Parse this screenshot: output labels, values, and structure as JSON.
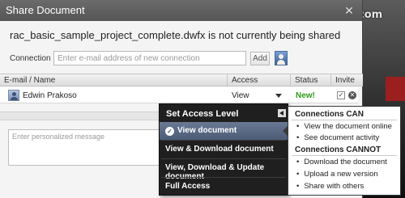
{
  "window": {
    "title": "Share Document"
  },
  "watermark": {
    "text": "CAD-notes.com"
  },
  "document": {
    "status_text": "rac_basic_sample_project_complete.dwfx is not currently being shared"
  },
  "connection": {
    "label": "Connection",
    "placeholder": "Enter e-mail address of new connection",
    "add_label": "Add"
  },
  "table": {
    "headers": [
      "E-mail / Name",
      "Access",
      "Status",
      "Invite"
    ],
    "rows": [
      {
        "name": "Edwin Prakoso",
        "access": "View",
        "status": "New!",
        "invite_checked": true
      }
    ]
  },
  "message": {
    "placeholder": "Enter personalized message"
  },
  "access_menu": {
    "title": "Set Access Level",
    "options": [
      {
        "label": "View document",
        "selected": true
      },
      {
        "label": "View & Download document",
        "selected": false
      },
      {
        "label": "View, Download & Update document",
        "selected": false
      },
      {
        "label": "Full Access",
        "selected": false
      }
    ]
  },
  "permissions": {
    "can_title": "Connections CAN",
    "can": [
      "View the document online",
      "See document activity"
    ],
    "cannot_title": "Connections CANNOT",
    "cannot": [
      "Download the document",
      "Upload a new version",
      "Share with others"
    ]
  },
  "colors": {
    "status_new": "#2e9a1a",
    "menu_bg": "#1f1f1f",
    "menu_selected": "#4b5b76",
    "titlebar": "#5f5f5f"
  }
}
